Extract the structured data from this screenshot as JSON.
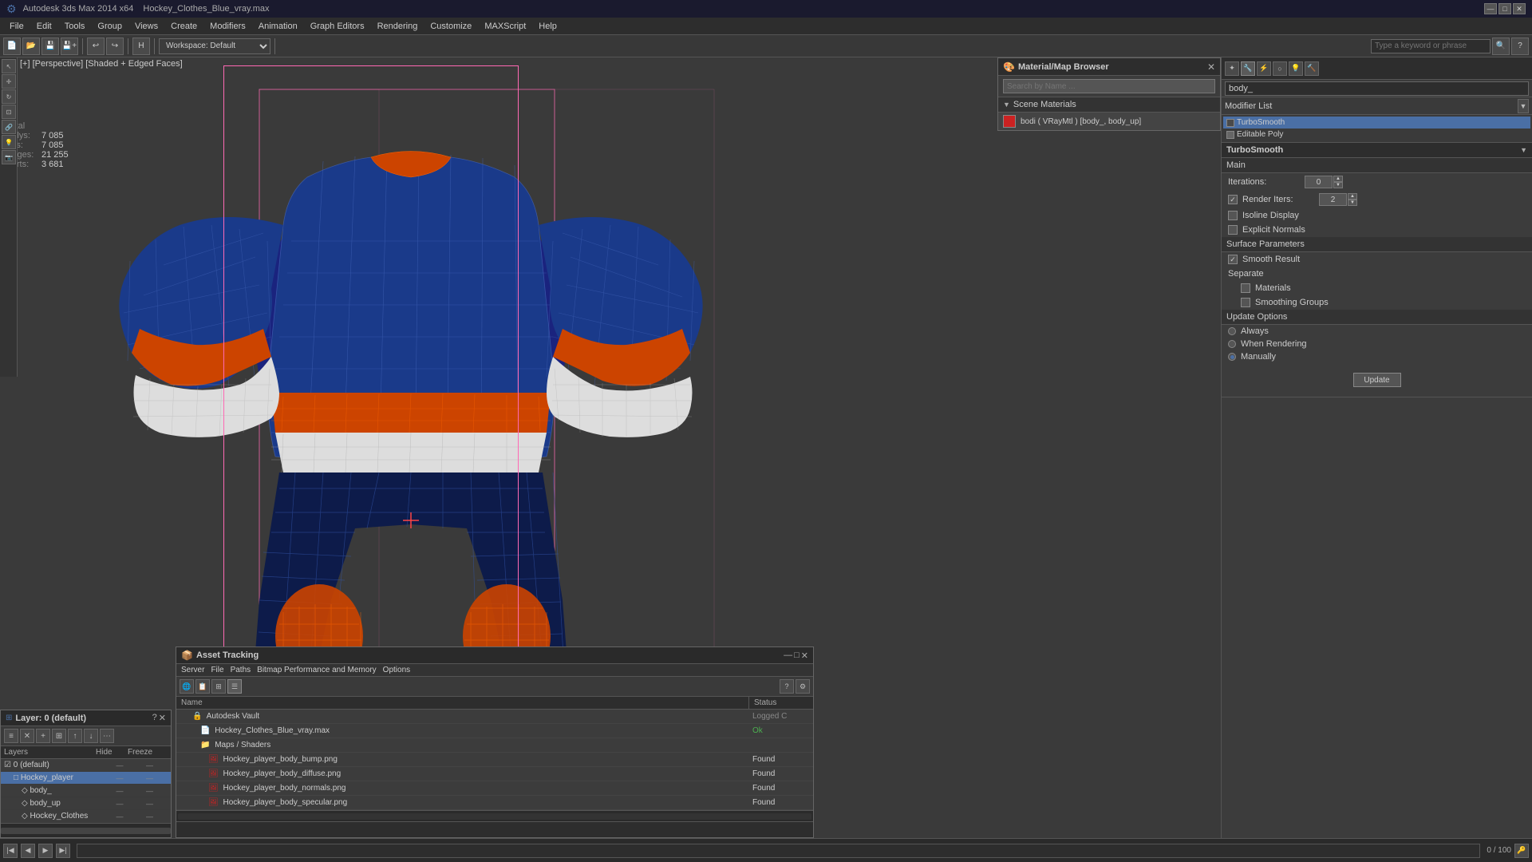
{
  "app": {
    "title": "Autodesk 3ds Max 2014 x64",
    "file": "Hockey_Clothes_Blue_vray.max",
    "workspace": "Workspace: Default"
  },
  "titlebar": {
    "close": "✕",
    "minimize": "—",
    "maximize": "□"
  },
  "menubar": {
    "items": [
      "File",
      "Edit",
      "Tools",
      "Group",
      "Views",
      "Create",
      "Modifiers",
      "Animation",
      "Graph Editors",
      "Rendering",
      "Customize",
      "MAXScript",
      "Help"
    ]
  },
  "toolbar": {
    "workspace_label": "Workspace: Default"
  },
  "viewport": {
    "label": "[+] [Perspective] [Shaded + Edged Faces]",
    "stats": {
      "total_label": "Total",
      "polys_label": "Polys:",
      "polys_value": "7 085",
      "tris_label": "Tris:",
      "tris_value": "7 085",
      "edges_label": "Edges:",
      "edges_value": "21 255",
      "verts_label": "Verts:",
      "verts_value": "3 681"
    }
  },
  "material_browser": {
    "title": "Material/Map Browser",
    "search_placeholder": "Search by Name ...",
    "scene_materials_label": "Scene Materials",
    "material_name": "bodi ( VRayMtl ) [body_, body_up]",
    "swatch_color": "#cc2222"
  },
  "modifier_panel": {
    "search_value": "body_",
    "modifier_list_label": "Modifier List",
    "stack_items": [
      {
        "name": "TurboSmooth",
        "active": true
      },
      {
        "name": "Editable Poly",
        "active": false
      }
    ]
  },
  "turbosmooth": {
    "title": "TurboSmooth",
    "main_label": "Main",
    "iterations_label": "Iterations:",
    "iterations_value": "0",
    "render_iters_label": "Render Iters:",
    "render_iters_value": "2",
    "isoline_display_label": "Isoline Display",
    "explicit_normals_label": "Explicit Normals",
    "surface_params_label": "Surface Parameters",
    "smooth_result_label": "Smooth Result",
    "smooth_result_checked": true,
    "separate_label": "Separate",
    "materials_label": "Materials",
    "materials_checked": false,
    "smoothing_groups_label": "Smoothing Groups",
    "smoothing_groups_checked": false,
    "update_options_label": "Update Options",
    "always_label": "Always",
    "always_checked": false,
    "when_rendering_label": "When Rendering",
    "when_rendering_checked": false,
    "manually_label": "Manually",
    "manually_checked": true,
    "update_btn_label": "Update"
  },
  "asset_tracking": {
    "title": "Asset Tracking",
    "menu_items": [
      "Server",
      "File",
      "Paths",
      "Bitmap Performance and Memory",
      "Options"
    ],
    "col_name": "Name",
    "col_status": "Status",
    "items": [
      {
        "name": "Autodesk Vault",
        "status": "Logged C",
        "indent": 0,
        "icon": "vault"
      },
      {
        "name": "Hockey_Clothes_Blue_vray.max",
        "status": "Ok",
        "indent": 1,
        "icon": "max"
      },
      {
        "name": "Maps / Shaders",
        "status": "",
        "indent": 1,
        "icon": "folder"
      },
      {
        "name": "Hockey_player_body_bump.png",
        "status": "Found",
        "indent": 2,
        "icon": "image"
      },
      {
        "name": "Hockey_player_body_diffuse.png",
        "status": "Found",
        "indent": 2,
        "icon": "image"
      },
      {
        "name": "Hockey_player_body_normals.png",
        "status": "Found",
        "indent": 2,
        "icon": "image"
      },
      {
        "name": "Hockey_player_body_specular.png",
        "status": "Found",
        "indent": 2,
        "icon": "image"
      }
    ]
  },
  "layers": {
    "title": "Layer: 0 (default)",
    "col_layers": "Layers",
    "col_hide": "Hide",
    "col_freeze": "Freeze",
    "items": [
      {
        "name": "0 (default)",
        "indent": 0,
        "selected": false,
        "hide": "",
        "freeze": ""
      },
      {
        "name": "Hockey_player",
        "indent": 1,
        "selected": true,
        "hide": "—",
        "freeze": "—"
      },
      {
        "name": "body_",
        "indent": 2,
        "selected": false,
        "hide": "—",
        "freeze": "—"
      },
      {
        "name": "body_up",
        "indent": 2,
        "selected": false,
        "hide": "—",
        "freeze": "—"
      },
      {
        "name": "Hockey_Clothes",
        "indent": 2,
        "selected": false,
        "hide": "—",
        "freeze": "—"
      }
    ]
  }
}
